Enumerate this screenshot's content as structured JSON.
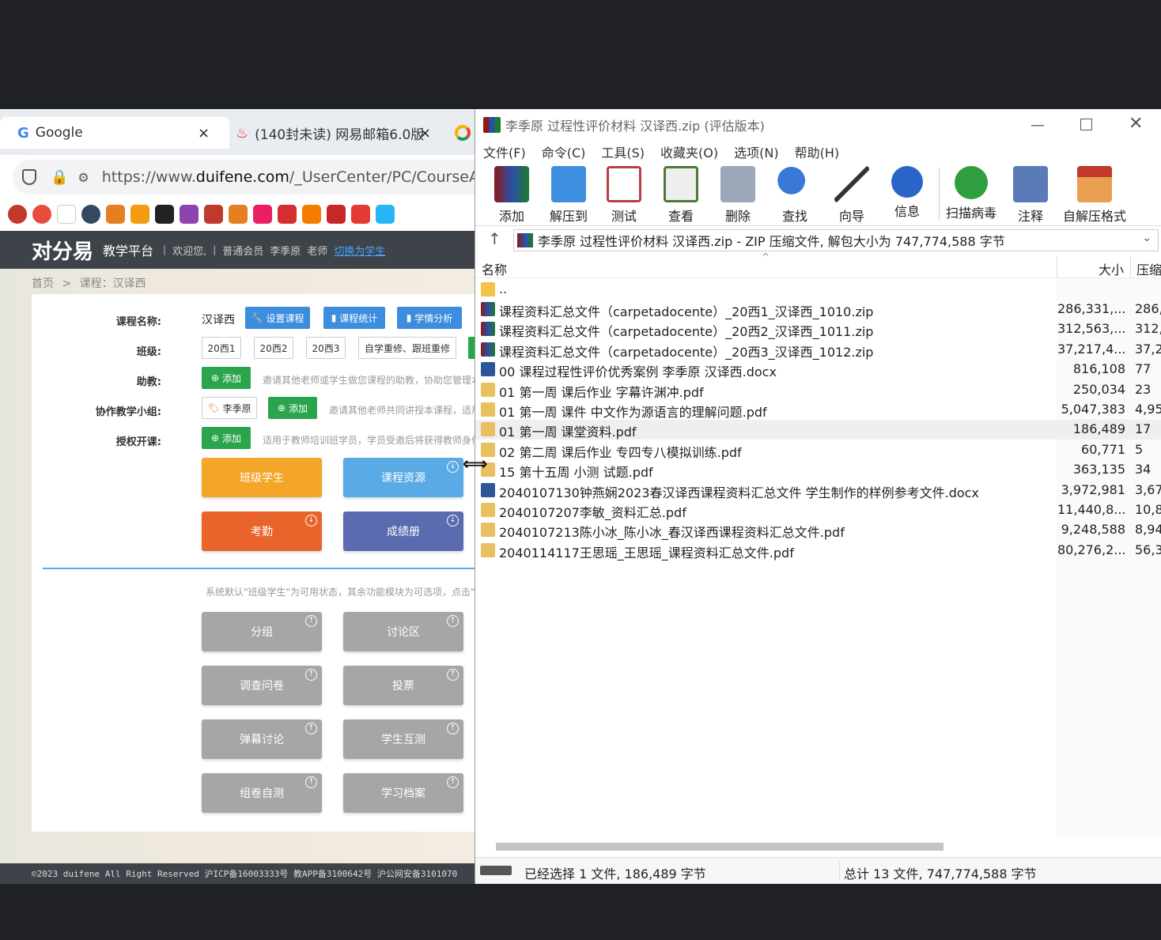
{
  "browser": {
    "tabs": [
      {
        "label": "Google",
        "close": "×"
      },
      {
        "label": "(140封未读) 网易邮箱6.0版",
        "close": "×"
      }
    ],
    "url_prefix": "https://www.",
    "url_domain": "duifene.com",
    "url_rest": "/_UserCenter/PC/CourseA"
  },
  "site": {
    "logo": "对分易",
    "platform": "教学平台",
    "welcome": "欢迎您,",
    "member": "普通会员",
    "user": "李季原",
    "role": "老师",
    "switch_link": "切换为学生",
    "breadcrumb_home": "首页",
    "breadcrumb_sep": ">",
    "breadcrumb_course": "课程：汉译西",
    "labels": {
      "course_name": "课程名称:",
      "class": "班级:",
      "assistant": "助教:",
      "coteach": "协作教学小组:",
      "auth": "授权开课:"
    },
    "course_name_value": "汉译西",
    "course_buttons": [
      "设置课程",
      "课程统计",
      "学情分析"
    ],
    "classes": [
      "20西1",
      "20西2",
      "20西3",
      "自学重修、跟班重修"
    ],
    "add_label": "添加",
    "coteach_member": "李季原",
    "notes": {
      "assistant": "邀请其他老师或学生做您课程的助教，协助您管理本",
      "coteach": "邀请其他老师共同讲授本课程，适用",
      "auth": "适用于教师培训班学员，学员受邀后将获得教师身份"
    },
    "tiles_main": [
      "班级学生",
      "课程资源",
      "考勤",
      "成绩册"
    ],
    "system_note": "系统默认\"班级学生\"为可用状态，其余功能模块为可选项，点击\"↑\"图",
    "tiles_optional": [
      "分组",
      "讨论区",
      "调查问卷",
      "投票",
      "弹幕讨论",
      "学生互测",
      "组卷自测",
      "学习档案"
    ],
    "footer": "©2023 duifene All Right Reserved   沪ICP备16003333号   教APP备3100642号   沪公网安备3101070"
  },
  "winrar": {
    "title": "李季原 过程性评价材料 汉译西.zip (评估版本)",
    "menu": [
      "文件(F)",
      "命令(C)",
      "工具(S)",
      "收藏夹(O)",
      "选项(N)",
      "帮助(H)"
    ],
    "toolbar": [
      "添加",
      "解压到",
      "测试",
      "查看",
      "删除",
      "查找",
      "向导",
      "信息",
      "扫描病毒",
      "注释",
      "自解压格式"
    ],
    "path": "李季原 过程性评价材料 汉译西.zip - ZIP 压缩文件, 解包大小为 747,774,588 字节",
    "col_name": "名称",
    "col_size": "大小",
    "col_packed": "压缩",
    "parent": "..",
    "files": [
      {
        "name": "课程资料汇总文件（carpetadocente）_20西1_汉译西_1010.zip",
        "size": "286,331,...",
        "packed": "286,",
        "type": "zip"
      },
      {
        "name": "课程资料汇总文件（carpetadocente）_20西2_汉译西_1011.zip",
        "size": "312,563,...",
        "packed": "312,",
        "type": "zip"
      },
      {
        "name": "课程资料汇总文件（carpetadocente）_20西3_汉译西_1012.zip",
        "size": "37,217,4...",
        "packed": "37,2",
        "type": "zip"
      },
      {
        "name": "00 课程过程性评价优秀案例 李季原 汉译西.docx",
        "size": "816,108",
        "packed": "77",
        "type": "docx"
      },
      {
        "name": "01 第一周 课后作业 字幕许渊冲.pdf",
        "size": "250,034",
        "packed": "23",
        "type": "pdf"
      },
      {
        "name": "01 第一周 课件 中文作为源语言的理解问题.pdf",
        "size": "5,047,383",
        "packed": "4,95",
        "type": "pdf"
      },
      {
        "name": "01 第一周 课堂资料.pdf",
        "size": "186,489",
        "packed": "17",
        "type": "pdf"
      },
      {
        "name": "02 第二周 课后作业 专四专八模拟训练.pdf",
        "size": "60,771",
        "packed": "5",
        "type": "pdf"
      },
      {
        "name": "15 第十五周 小测 试题.pdf",
        "size": "363,135",
        "packed": "34",
        "type": "pdf"
      },
      {
        "name": "2040107130钟燕娴2023春汉译西课程资料汇总文件 学生制作的样例参考文件.docx",
        "size": "3,972,981",
        "packed": "3,67",
        "type": "docx"
      },
      {
        "name": "2040107207李敏_资料汇总.pdf",
        "size": "11,440,8...",
        "packed": "10,8",
        "type": "pdf"
      },
      {
        "name": "2040107213陈小冰_陈小冰_春汉译西课程资料汇总文件.pdf",
        "size": "9,248,588",
        "packed": "8,94",
        "type": "pdf"
      },
      {
        "name": "2040114117王思瑶_王思瑶_课程资料汇总文件.pdf",
        "size": "80,276,2...",
        "packed": "56,3",
        "type": "pdf"
      }
    ],
    "status_left": "已经选择 1 文件, 186,489 字节",
    "status_right": "总计 13 文件, 747,774,588 字节"
  }
}
